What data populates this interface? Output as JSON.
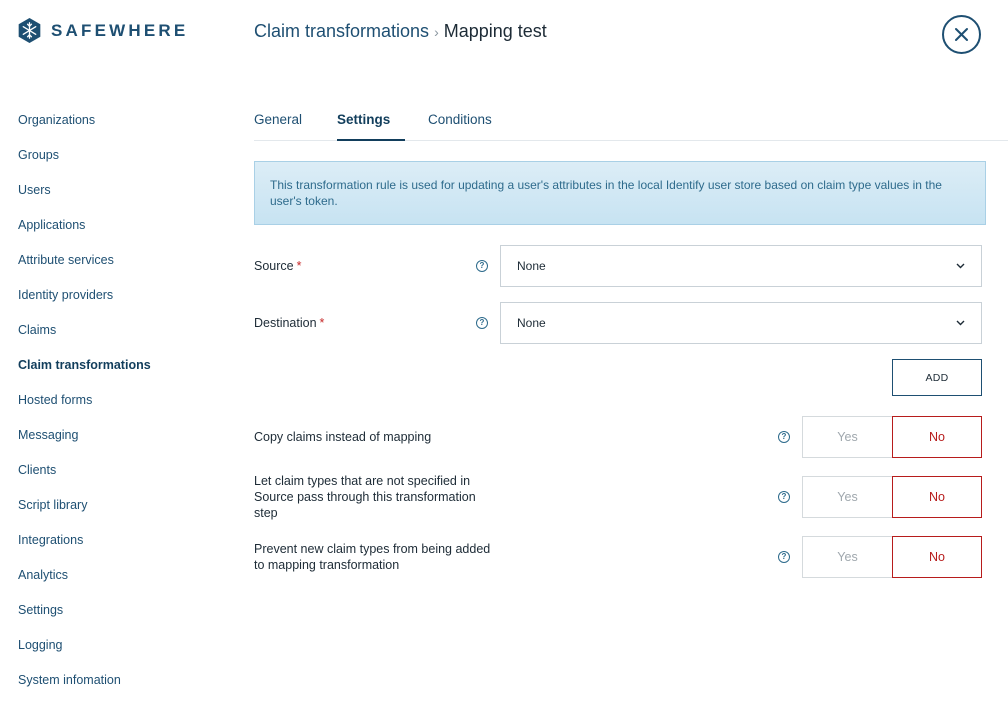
{
  "brand": {
    "name": "SAFEWHERE",
    "color": "#1e4f72"
  },
  "breadcrumb": {
    "parent": "Claim transformations",
    "separator": "›",
    "current": "Mapping test"
  },
  "sidebar": {
    "items": [
      {
        "label": "Organizations",
        "active": false
      },
      {
        "label": "Groups",
        "active": false
      },
      {
        "label": "Users",
        "active": false
      },
      {
        "label": "Applications",
        "active": false
      },
      {
        "label": "Attribute services",
        "active": false
      },
      {
        "label": "Identity providers",
        "active": false
      },
      {
        "label": "Claims",
        "active": false
      },
      {
        "label": "Claim transformations",
        "active": true
      },
      {
        "label": "Hosted forms",
        "active": false
      },
      {
        "label": "Messaging",
        "active": false
      },
      {
        "label": "Clients",
        "active": false
      },
      {
        "label": "Script library",
        "active": false
      },
      {
        "label": "Integrations",
        "active": false
      },
      {
        "label": "Analytics",
        "active": false
      },
      {
        "label": "Settings",
        "active": false
      },
      {
        "label": "Logging",
        "active": false
      },
      {
        "label": "System infomation",
        "active": false
      }
    ]
  },
  "tabs": [
    {
      "label": "General",
      "active": false
    },
    {
      "label": "Settings",
      "active": true
    },
    {
      "label": "Conditions",
      "active": false
    }
  ],
  "info_message": "This transformation rule is used for updating a user's attributes in the local Identify user store based on claim type values in the user's token.",
  "form": {
    "source": {
      "label": "Source",
      "required_mark": "*",
      "value": "None",
      "help": "?"
    },
    "destination": {
      "label": "Destination",
      "required_mark": "*",
      "value": "None",
      "help": "?"
    },
    "add_label": "ADD"
  },
  "toggles": [
    {
      "label": "Copy claims instead of mapping",
      "yes": "Yes",
      "no": "No",
      "selected": "No",
      "help": "?"
    },
    {
      "label": "Let claim types that are not specified in Source pass through this transformation step",
      "yes": "Yes",
      "no": "No",
      "selected": "No",
      "help": "?"
    },
    {
      "label": "Prevent new claim types from being added to mapping transformation",
      "yes": "Yes",
      "no": "No",
      "selected": "No",
      "help": "?"
    }
  ],
  "colors": {
    "accent": "#1e4f72",
    "danger": "#b71c1c",
    "info_bg": "#d3e9f5"
  }
}
